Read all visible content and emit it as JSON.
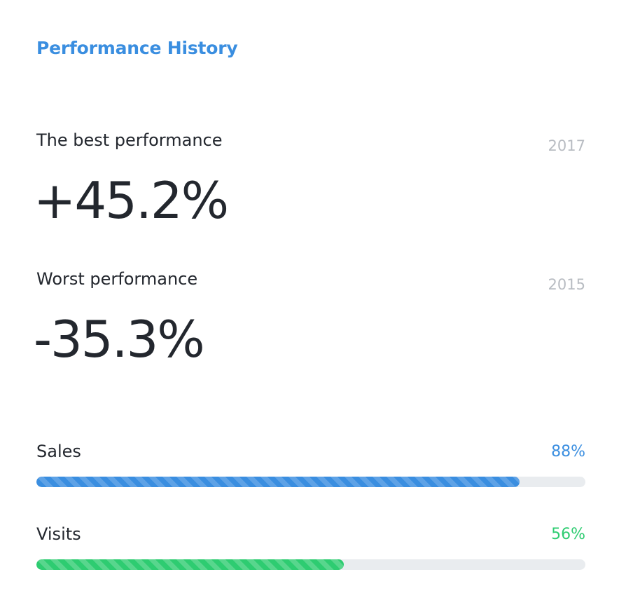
{
  "card": {
    "title": "Performance History"
  },
  "best": {
    "label": "The best performance",
    "year": "2017",
    "value": "+45.2%"
  },
  "worst": {
    "label": "Worst performance",
    "year": "2015",
    "value": "-35.3%"
  },
  "bars": {
    "sales": {
      "label": "Sales",
      "percent_text": "88%",
      "percent": 88,
      "color": "#3a8ee0"
    },
    "visits": {
      "label": "Visits",
      "percent_text": "56%",
      "percent": 56,
      "color": "#2ecc71"
    }
  },
  "colors": {
    "accent": "#3a8ee0",
    "success": "#2ecc71",
    "track": "#e9ecef",
    "muted": "#b8bcc2",
    "text": "#23272e"
  }
}
